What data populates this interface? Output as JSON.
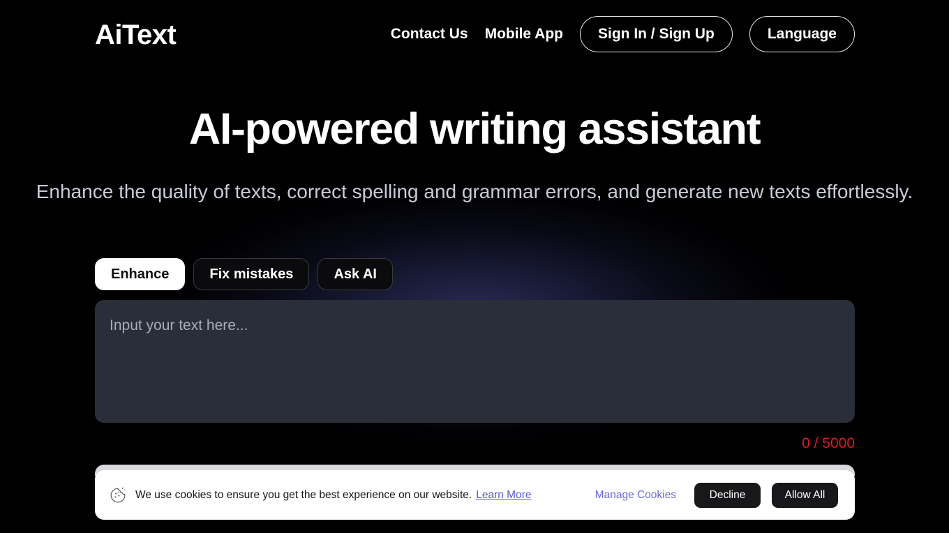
{
  "header": {
    "logo": "AiText",
    "nav_links": [
      {
        "label": "Contact Us"
      },
      {
        "label": "Mobile App"
      }
    ],
    "nav_pills": [
      {
        "label": "Sign In / Sign Up"
      },
      {
        "label": "Language"
      }
    ]
  },
  "hero": {
    "headline": "AI-powered writing assistant",
    "subhead": "Enhance the quality of texts, correct spelling and grammar errors, and generate new texts effortlessly."
  },
  "tabs": [
    {
      "label": "Enhance",
      "active": true
    },
    {
      "label": "Fix mistakes",
      "active": false
    },
    {
      "label": "Ask AI",
      "active": false
    }
  ],
  "editor": {
    "placeholder": "Input your text here...",
    "value": "",
    "counter": "0 / 5000",
    "counter_color": "#e01a1a",
    "char_count": 0,
    "char_limit": 5000
  },
  "cookie_banner": {
    "icon": "cookie-icon",
    "message": "We use cookies to ensure you get the best experience on our website.",
    "learn_more": "Learn More",
    "manage": "Manage Cookies",
    "decline": "Decline",
    "allow_all": "Allow All",
    "link_color": "#5b5bd6"
  }
}
